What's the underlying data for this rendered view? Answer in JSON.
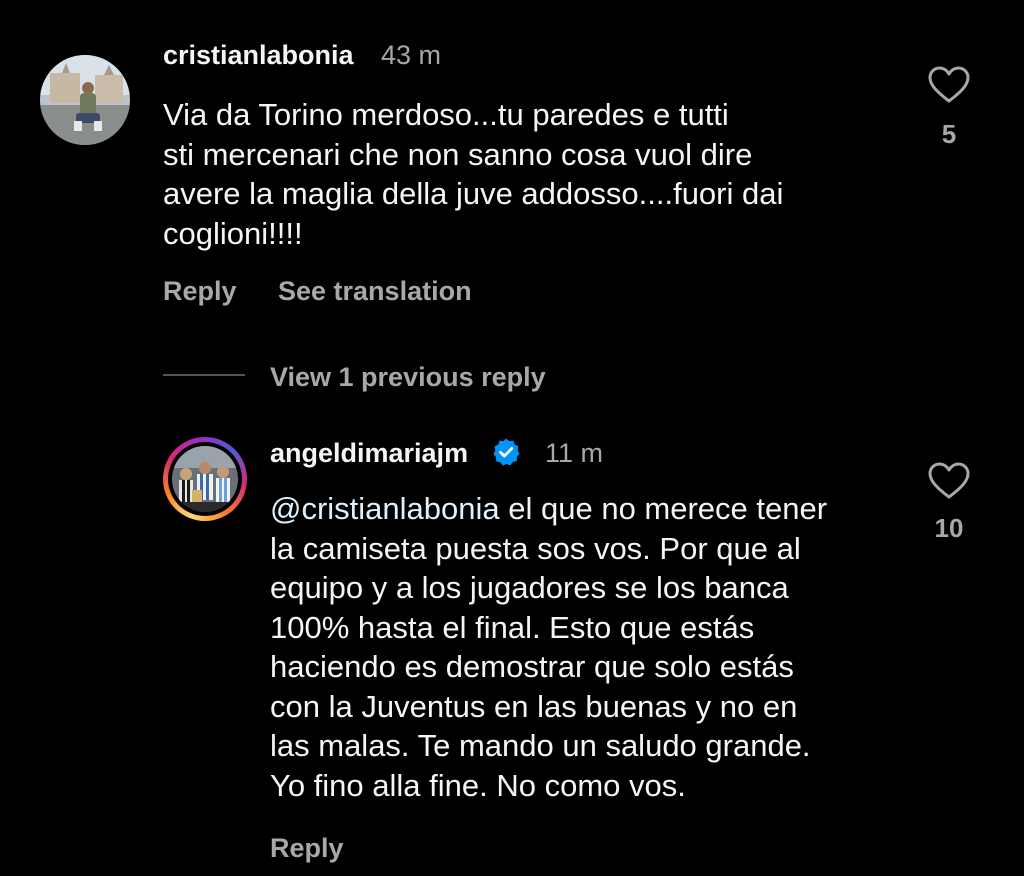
{
  "comment": {
    "username": "cristianlabonia",
    "time": "43 m",
    "text": "Via da Torino merdoso...tu paredes e tutti\nsti mercenari che non sanno cosa vuol dire\navere la maglia della juve addosso....fuori dai\ncoglioni!!!!",
    "likes": "5",
    "reply_label": "Reply",
    "translate_label": "See translation",
    "avatar_icon": "profile-photo"
  },
  "thread": {
    "view_previous_label": "View 1 previous reply"
  },
  "reply": {
    "username": "angeldimariajm",
    "verified": true,
    "time": "11 m",
    "mention": "@cristianlabonia",
    "text": " el que no merece tener\nla camiseta puesta sos vos. Por que al\nequipo y a los jugadores se los banca\n100% hasta el final. Esto que estás\nhaciendo es demostrar que solo estás\ncon la Juventus en las buenas y no en\nlas malas. Te mando un saludo grande.\nYo fino alla fine. No como vos.",
    "likes": "10",
    "reply_label": "Reply",
    "avatar_icon": "profile-photo-with-story-ring"
  },
  "colors": {
    "background": "#000000",
    "primary_text": "#f5f5f5",
    "secondary_text": "#a8a8a8",
    "verified_badge": "#0095f6"
  }
}
